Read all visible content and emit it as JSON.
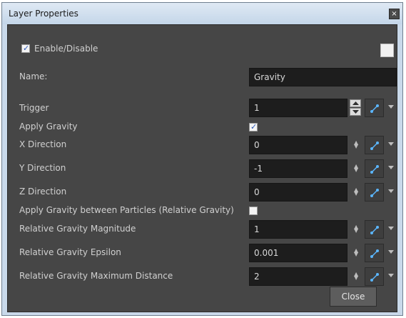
{
  "window": {
    "title": "Layer Properties",
    "close_symbol": "×"
  },
  "enable": {
    "label": "Enable/Disable",
    "checked": true
  },
  "name": {
    "label": "Name:",
    "value": "Gravity"
  },
  "rows": [
    {
      "label": "Trigger",
      "value": "1"
    },
    {
      "label": "Apply Gravity"
    },
    {
      "label": "X Direction",
      "value": "0"
    },
    {
      "label": "Y Direction",
      "value": "-1"
    },
    {
      "label": "Z Direction",
      "value": "0"
    },
    {
      "label": "Apply Gravity between Particles (Relative Gravity)"
    },
    {
      "label": "Relative Gravity Magnitude",
      "value": "1"
    },
    {
      "label": "Relative Gravity Epsilon",
      "value": "0.001"
    },
    {
      "label": "Relative Gravity Maximum Distance",
      "value": "2"
    }
  ],
  "apply_gravity_checked": true,
  "relative_gravity_checked": false,
  "buttons": {
    "close_label": "Close"
  },
  "colors": {
    "panel": "#464646",
    "field": "#1d1d1d",
    "check_mark": "#2a56b8",
    "fn_icon": "#5bb6ff"
  }
}
